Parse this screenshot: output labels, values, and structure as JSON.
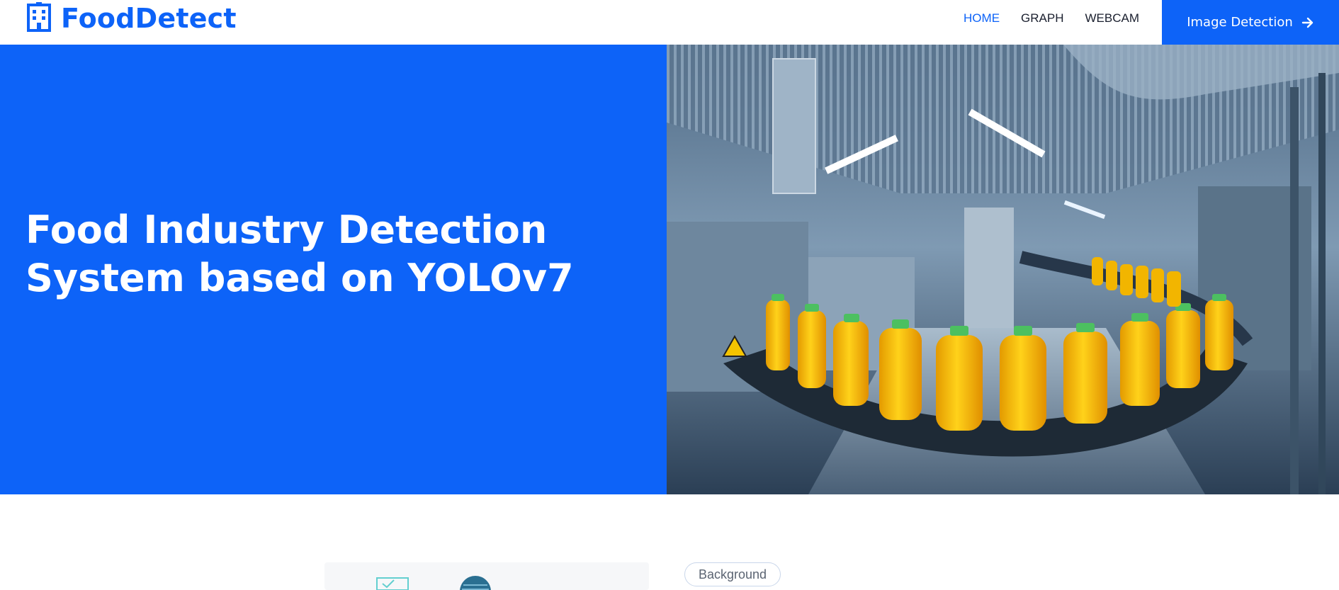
{
  "brand": {
    "name": "FoodDetect",
    "icon": "building-icon",
    "color": "#0d63f8"
  },
  "nav": {
    "items": [
      {
        "label": "HOME",
        "active": true
      },
      {
        "label": "GRAPH",
        "active": false
      },
      {
        "label": "WEBCAM",
        "active": false
      }
    ],
    "cta": {
      "label": "Image Detection",
      "icon": "arrow-right-icon"
    }
  },
  "hero": {
    "title": "Food Industry Detection System based on YOLOv7",
    "image": "juice-bottling-factory-photo",
    "background": "#0d63f8"
  },
  "section": {
    "badge": "Background"
  }
}
